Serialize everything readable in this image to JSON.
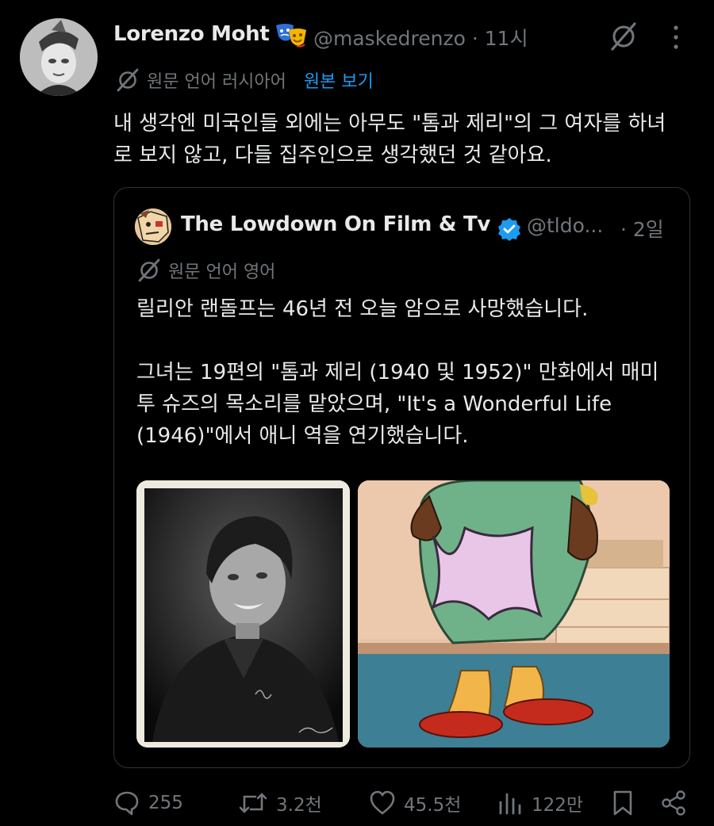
{
  "post": {
    "author_name": "Lorenzo Moht",
    "author_handle": "@maskedrenzo",
    "time": "· 11시",
    "translate_label": "원문 언어 러시아어",
    "translate_link": "원본 보기",
    "text": "내 생각엔 미국인들 외에는 아무도 \"톰과 제리\"의 그 여자를 하녀로 보지 않고, 다들 집주인으로 생각했던 것 같아요."
  },
  "quote": {
    "author_name": "The Lowdown On Film & Tv",
    "author_handle": "@tldo...",
    "time": "· 2일",
    "translate_label": "원문 언어 영어",
    "text": "릴리안 랜돌프는 46년 전 오늘 암으로 사망했습니다.\n\n그녀는 19편의 \"톰과 제리 (1940 및 1952)\" 만화에서 매미 투 슈즈의 목소리를 맡았으며, \"It's a Wonderful Life (1946)\"에서 애니 역을 연기했습니다."
  },
  "actions": {
    "replies": "255",
    "reposts": "3.2천",
    "likes": "45.5천",
    "views": "122만"
  },
  "icons": {
    "emoji": "theater-masks-icon",
    "translate": "translate-icon",
    "grok": "grok-icon",
    "more": "more-icon",
    "verified": "verified-badge-icon"
  },
  "colors": {
    "background": "#000000",
    "text": "#e7e9ea",
    "muted": "#71767b",
    "link": "#1d9bf0",
    "border": "#2f3336"
  }
}
